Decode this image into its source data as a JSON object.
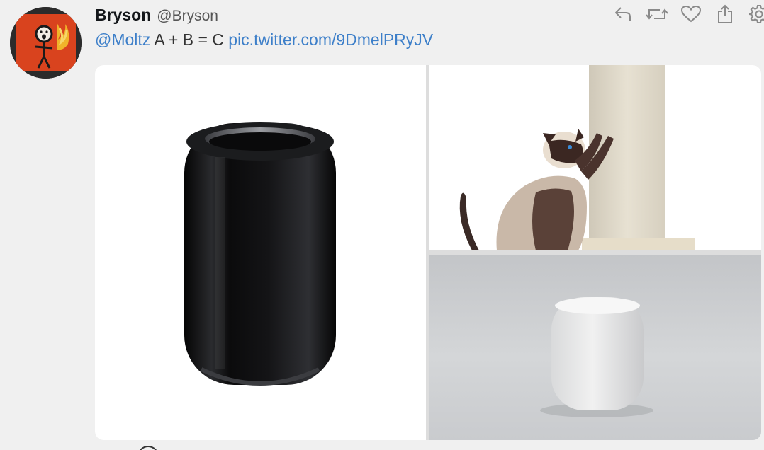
{
  "tweet": {
    "author": {
      "display_name": "Bryson",
      "handle": "@Bryson",
      "avatar_icon": "stick-figure-fire-icon"
    },
    "text": {
      "mention": "@Moltz",
      "body": " A + B = C ",
      "link": "pic.twitter.com/9DmelPRyJV"
    },
    "actions": [
      {
        "icon": "reply-icon"
      },
      {
        "icon": "retweet-icon"
      },
      {
        "icon": "like-icon"
      },
      {
        "icon": "share-icon"
      },
      {
        "icon": "settings-gear-icon"
      }
    ],
    "media": [
      {
        "subject": "mac-pro-cylinder"
      },
      {
        "subject": "siamese-cat-scratching-post"
      },
      {
        "subject": "homepod-speaker"
      }
    ]
  },
  "colors": {
    "background": "#f0f0f0",
    "link": "#3d7fc9",
    "icon": "#8a8a8a",
    "avatar_bg": "#d9431e"
  }
}
